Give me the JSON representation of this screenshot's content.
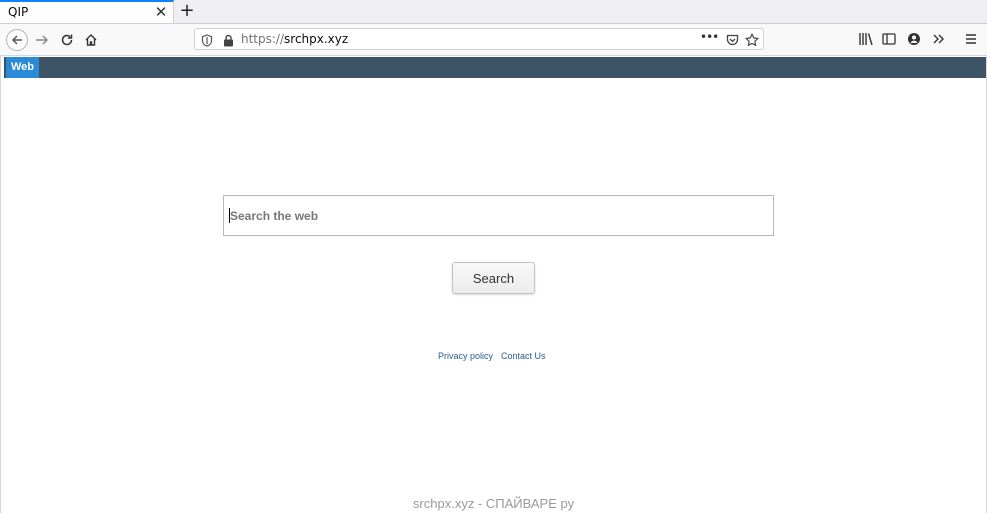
{
  "browser": {
    "tab": {
      "title": "QIP",
      "close_symbol": "✕"
    },
    "newtab_symbol": "+",
    "url": {
      "scheme": "https://",
      "host": "srchpx.xyz"
    },
    "page_actions_symbol": "•••",
    "icons": [
      "back-icon",
      "forward-icon",
      "reload-icon",
      "home-icon",
      "shield-icon",
      "lock-icon",
      "pocket-icon",
      "bookmark-star-icon",
      "library-icon",
      "sidebar-icon",
      "account-icon",
      "overflow-icon",
      "menu-icon"
    ]
  },
  "page": {
    "nav": {
      "web_label": "Web"
    },
    "search": {
      "placeholder": "Search the web",
      "value": "",
      "button_label": "Search"
    },
    "footer": {
      "privacy_label": "Privacy policy",
      "contact_label": "Contact Us"
    }
  },
  "watermark": "srchpx.xyz - СПАЙВАРЕ ру",
  "colors": {
    "nav_bar": "#3d5366",
    "web_tab": "#2a8ad6",
    "tab_accent": "#0a84ff",
    "links": "#2a5a9a"
  }
}
